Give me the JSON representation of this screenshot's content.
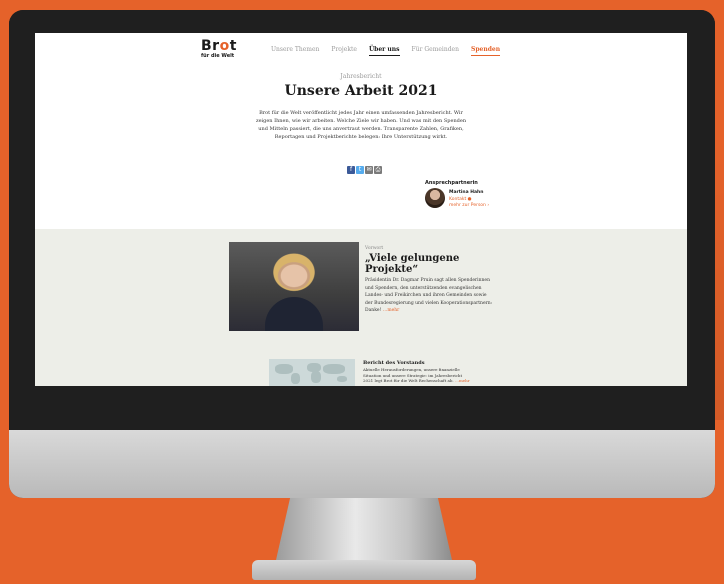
{
  "site": {
    "logo_line1": "Brot",
    "logo_line2": "für die Welt"
  },
  "nav": {
    "items": [
      "Unsere Themen",
      "Projekte",
      "Über uns",
      "Für Gemeinden",
      "Spenden"
    ],
    "active": "Über uns"
  },
  "page": {
    "kicker": "Jahresbericht",
    "title": "Unsere Arbeit 2021",
    "intro": "Brot für die Welt veröffentlicht jedes Jahr einen umfassenden Jahresbericht. Wir zeigen Ihnen, wie wir arbeiten. Welche Ziele wir haben. Und was mit den Spenden und Mitteln passiert, die uns anvertraut werden. Transparente Zahlen, Grafiken, Reportagen und Projektberichte belegen: Ihre Unterstützung wirkt."
  },
  "share": {
    "icons": [
      "facebook-icon",
      "twitter-icon",
      "email-icon",
      "print-icon"
    ]
  },
  "contact": {
    "heading": "Ansprechpartnerin",
    "name": "Martina Hahn",
    "link_contact": "Kontakt",
    "link_more": "mehr zur Person"
  },
  "feature": {
    "kicker": "Vorwort",
    "title": "„Viele gelungene Projekte“",
    "text": "Präsidentin Dr. Dagmar Pruin sagt allen Spenderinnen und Spendern, den unterstützenden evangelischen Landes- und Freikirchen und ihren Gemeinden sowie der Bundesregierung und vielen Kooperationspartnern: Danke!",
    "more": "…mehr"
  },
  "report": {
    "title": "Bericht des Vorstands",
    "text": "Aktuelle Herausforderungen, unsere finanzielle Situation und unsere Strategie: im Jahresbericht 2021 legt Brot für die Welt Rechenschaft ab.",
    "more": "…mehr"
  },
  "colors": {
    "accent": "#e5622a",
    "background": "#e5622a",
    "band": "#edeee8"
  }
}
